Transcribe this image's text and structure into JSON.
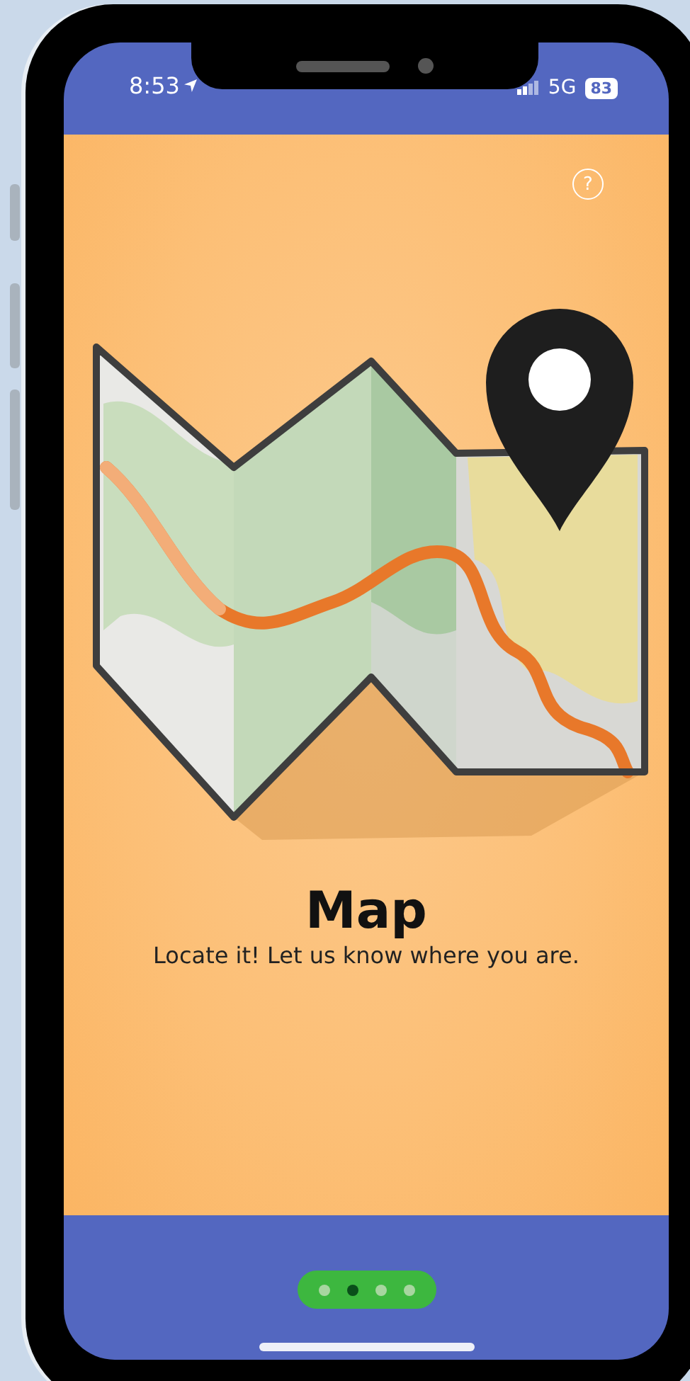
{
  "status_bar": {
    "time": "8:53",
    "network": "5G",
    "battery": "83"
  },
  "help_button": {
    "label": "?"
  },
  "title": "Map",
  "subtitle": "Locate it! Let us know where you are.",
  "pager": [
    {
      "selected": false
    },
    {
      "selected": true
    },
    {
      "selected": false
    },
    {
      "selected": false
    }
  ]
}
